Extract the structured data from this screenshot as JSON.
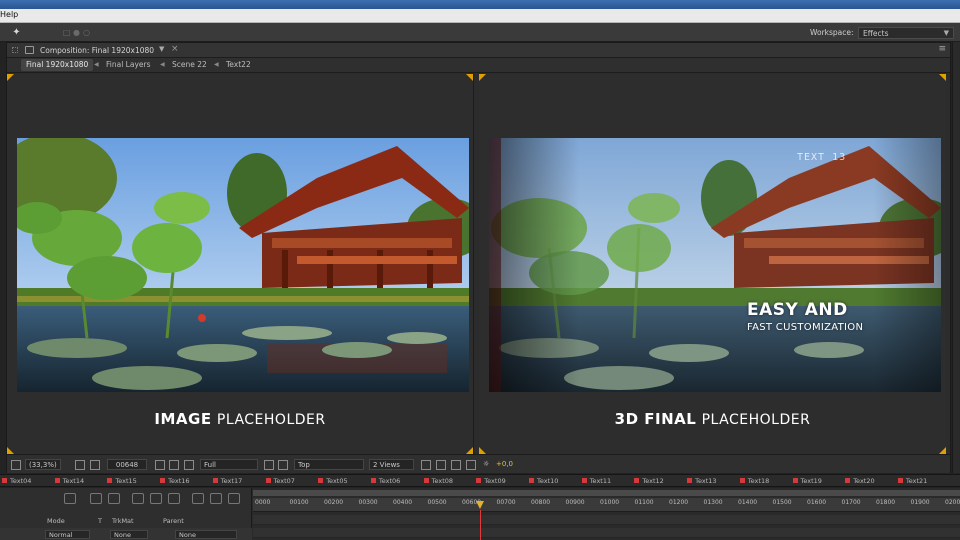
{
  "menubar": {
    "help_label": "Help"
  },
  "toolbar": {
    "workspace_label": "Workspace:",
    "workspace_value": "Effects"
  },
  "composition": {
    "tab_title": "Composition: Final 1920x1080",
    "breadcrumbs": [
      "Final 1920x1080",
      "Final Layers",
      "Scene 22",
      "Text22"
    ]
  },
  "viewers": {
    "left_caption_bold": "IMAGE",
    "left_caption_light": "PLACEHOLDER",
    "right_caption_bold": "3D FINAL",
    "right_caption_light": "PLACEHOLDER",
    "right_overlay_small": "TEXT 13",
    "right_overlay_title": "EASY AND",
    "right_overlay_subtitle": "FAST CUSTOMIZATION"
  },
  "viewer_bar": {
    "zoom": "(33,3%)",
    "timecode": "00648",
    "resolution": "Full",
    "view": "Top",
    "views_layout": "2 Views",
    "exposure": "+0,0"
  },
  "timeline_tabs": [
    "Text04",
    "Text14",
    "Text15",
    "Text16",
    "Text17",
    "Text07",
    "Text05",
    "Text06",
    "Text08",
    "Text09",
    "Text10",
    "Text11",
    "Text12",
    "Text13",
    "Text18",
    "Text19",
    "Text20",
    "Text21"
  ],
  "timeline": {
    "ruler_labels": [
      "0000",
      "00100",
      "00200",
      "00300",
      "00400",
      "00500",
      "00600",
      "00700",
      "00800",
      "00900",
      "01000",
      "01100",
      "01200",
      "01300",
      "01400",
      "01500",
      "01600",
      "01700",
      "01800",
      "01900",
      "02000"
    ],
    "columns": {
      "mode": "Mode",
      "t": "T",
      "trkmat": "TrkMat",
      "parent": "Parent"
    },
    "layer_mode": "Normal",
    "layer_trkmat": "None",
    "layer_parent": "None"
  },
  "colors": {
    "accent": "#e0a000",
    "label_red": "#d53a3a",
    "panel": "#2c2c2c",
    "playhead": "#e03a3a"
  }
}
